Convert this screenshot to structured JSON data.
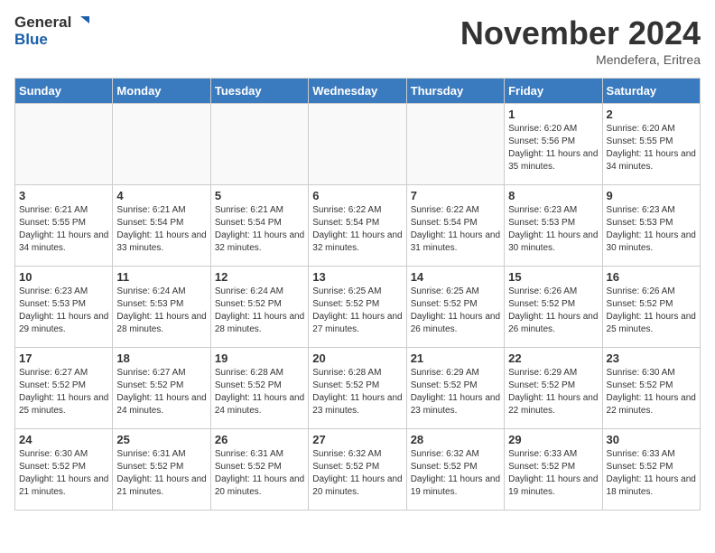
{
  "header": {
    "logo_line1": "General",
    "logo_line2": "Blue",
    "month": "November 2024",
    "location": "Mendefera, Eritrea"
  },
  "weekdays": [
    "Sunday",
    "Monday",
    "Tuesday",
    "Wednesday",
    "Thursday",
    "Friday",
    "Saturday"
  ],
  "weeks": [
    [
      {
        "day": "",
        "info": ""
      },
      {
        "day": "",
        "info": ""
      },
      {
        "day": "",
        "info": ""
      },
      {
        "day": "",
        "info": ""
      },
      {
        "day": "",
        "info": ""
      },
      {
        "day": "1",
        "info": "Sunrise: 6:20 AM\nSunset: 5:56 PM\nDaylight: 11 hours\nand 35 minutes."
      },
      {
        "day": "2",
        "info": "Sunrise: 6:20 AM\nSunset: 5:55 PM\nDaylight: 11 hours\nand 34 minutes."
      }
    ],
    [
      {
        "day": "3",
        "info": "Sunrise: 6:21 AM\nSunset: 5:55 PM\nDaylight: 11 hours\nand 34 minutes."
      },
      {
        "day": "4",
        "info": "Sunrise: 6:21 AM\nSunset: 5:54 PM\nDaylight: 11 hours\nand 33 minutes."
      },
      {
        "day": "5",
        "info": "Sunrise: 6:21 AM\nSunset: 5:54 PM\nDaylight: 11 hours\nand 32 minutes."
      },
      {
        "day": "6",
        "info": "Sunrise: 6:22 AM\nSunset: 5:54 PM\nDaylight: 11 hours\nand 32 minutes."
      },
      {
        "day": "7",
        "info": "Sunrise: 6:22 AM\nSunset: 5:54 PM\nDaylight: 11 hours\nand 31 minutes."
      },
      {
        "day": "8",
        "info": "Sunrise: 6:23 AM\nSunset: 5:53 PM\nDaylight: 11 hours\nand 30 minutes."
      },
      {
        "day": "9",
        "info": "Sunrise: 6:23 AM\nSunset: 5:53 PM\nDaylight: 11 hours\nand 30 minutes."
      }
    ],
    [
      {
        "day": "10",
        "info": "Sunrise: 6:23 AM\nSunset: 5:53 PM\nDaylight: 11 hours\nand 29 minutes."
      },
      {
        "day": "11",
        "info": "Sunrise: 6:24 AM\nSunset: 5:53 PM\nDaylight: 11 hours\nand 28 minutes."
      },
      {
        "day": "12",
        "info": "Sunrise: 6:24 AM\nSunset: 5:52 PM\nDaylight: 11 hours\nand 28 minutes."
      },
      {
        "day": "13",
        "info": "Sunrise: 6:25 AM\nSunset: 5:52 PM\nDaylight: 11 hours\nand 27 minutes."
      },
      {
        "day": "14",
        "info": "Sunrise: 6:25 AM\nSunset: 5:52 PM\nDaylight: 11 hours\nand 26 minutes."
      },
      {
        "day": "15",
        "info": "Sunrise: 6:26 AM\nSunset: 5:52 PM\nDaylight: 11 hours\nand 26 minutes."
      },
      {
        "day": "16",
        "info": "Sunrise: 6:26 AM\nSunset: 5:52 PM\nDaylight: 11 hours\nand 25 minutes."
      }
    ],
    [
      {
        "day": "17",
        "info": "Sunrise: 6:27 AM\nSunset: 5:52 PM\nDaylight: 11 hours\nand 25 minutes."
      },
      {
        "day": "18",
        "info": "Sunrise: 6:27 AM\nSunset: 5:52 PM\nDaylight: 11 hours\nand 24 minutes."
      },
      {
        "day": "19",
        "info": "Sunrise: 6:28 AM\nSunset: 5:52 PM\nDaylight: 11 hours\nand 24 minutes."
      },
      {
        "day": "20",
        "info": "Sunrise: 6:28 AM\nSunset: 5:52 PM\nDaylight: 11 hours\nand 23 minutes."
      },
      {
        "day": "21",
        "info": "Sunrise: 6:29 AM\nSunset: 5:52 PM\nDaylight: 11 hours\nand 23 minutes."
      },
      {
        "day": "22",
        "info": "Sunrise: 6:29 AM\nSunset: 5:52 PM\nDaylight: 11 hours\nand 22 minutes."
      },
      {
        "day": "23",
        "info": "Sunrise: 6:30 AM\nSunset: 5:52 PM\nDaylight: 11 hours\nand 22 minutes."
      }
    ],
    [
      {
        "day": "24",
        "info": "Sunrise: 6:30 AM\nSunset: 5:52 PM\nDaylight: 11 hours\nand 21 minutes."
      },
      {
        "day": "25",
        "info": "Sunrise: 6:31 AM\nSunset: 5:52 PM\nDaylight: 11 hours\nand 21 minutes."
      },
      {
        "day": "26",
        "info": "Sunrise: 6:31 AM\nSunset: 5:52 PM\nDaylight: 11 hours\nand 20 minutes."
      },
      {
        "day": "27",
        "info": "Sunrise: 6:32 AM\nSunset: 5:52 PM\nDaylight: 11 hours\nand 20 minutes."
      },
      {
        "day": "28",
        "info": "Sunrise: 6:32 AM\nSunset: 5:52 PM\nDaylight: 11 hours\nand 19 minutes."
      },
      {
        "day": "29",
        "info": "Sunrise: 6:33 AM\nSunset: 5:52 PM\nDaylight: 11 hours\nand 19 minutes."
      },
      {
        "day": "30",
        "info": "Sunrise: 6:33 AM\nSunset: 5:52 PM\nDaylight: 11 hours\nand 18 minutes."
      }
    ]
  ]
}
